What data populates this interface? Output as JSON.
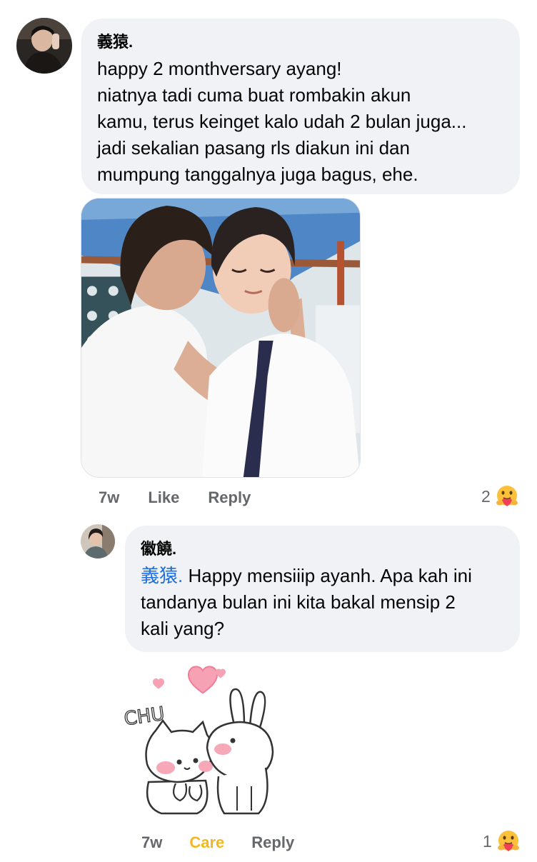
{
  "comment": {
    "author": "義猿.",
    "lines": [
      "happy 2 monthversary ayang!",
      "niatnya tadi cuma buat rombakin akun",
      "kamu, terus keinget kalo udah 2 bulan juga...",
      "jadi sekalian pasang rls diakun ini dan",
      "mumpung tanggalnya juga bagus, ehe."
    ],
    "time": "7w",
    "like_label": "Like",
    "reply_label": "Reply",
    "reaction_count": "2",
    "reaction_icon": "care-emoji-icon"
  },
  "reply": {
    "author": "徽饒.",
    "mention": "義猿.",
    "lines": [
      " Happy mensiiip ayanh. Apa kah ini",
      "tandanya bulan ini kita bakal mensip 2",
      "kali yang?"
    ],
    "sticker_text": "CHU",
    "time": "7w",
    "care_label": "Care",
    "reply_label": "Reply",
    "reaction_count": "1",
    "reaction_icon": "care-emoji-icon"
  },
  "colors": {
    "bubble": "#f0f2f5",
    "mention": "#216fdb",
    "care": "#f2b91f",
    "meta": "#65676b"
  }
}
